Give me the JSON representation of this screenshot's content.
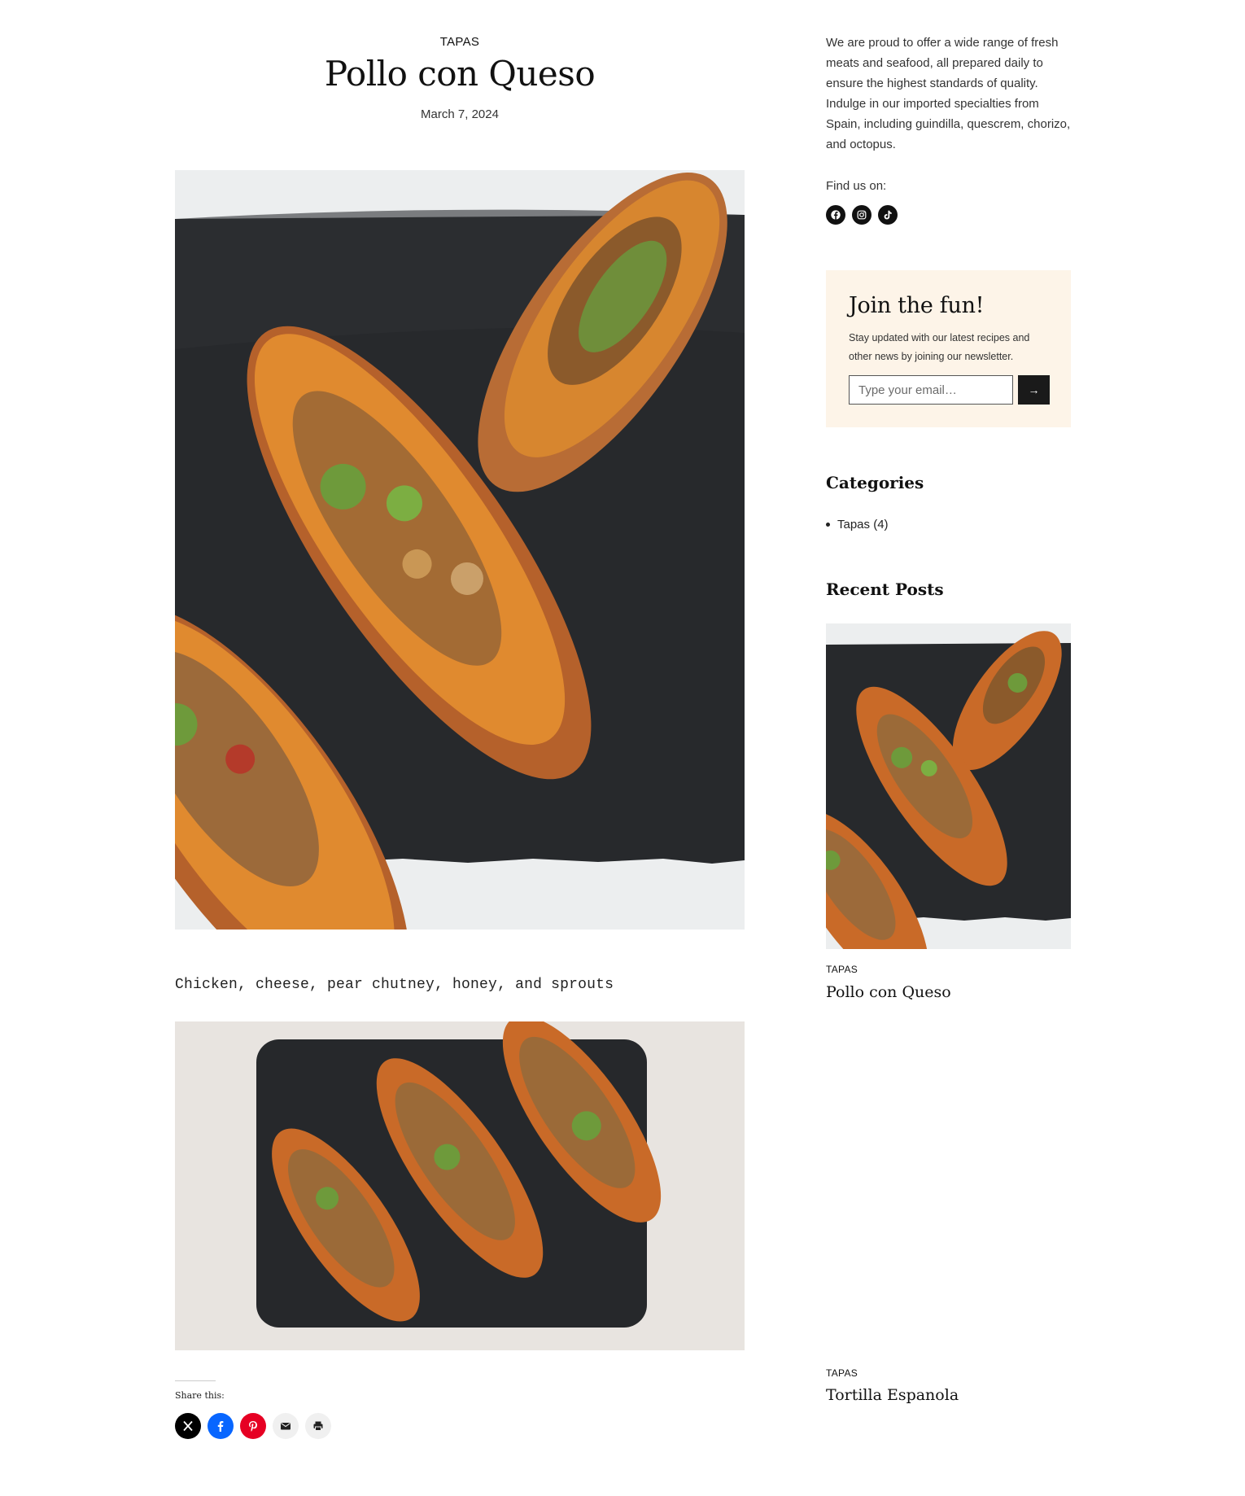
{
  "post": {
    "category": "TAPAS",
    "title": "Pollo con Queso",
    "date": "March 7, 2024",
    "caption": "Chicken, cheese, pear chutney, honey, and sprouts"
  },
  "share": {
    "label": "Share this:",
    "buttons": [
      {
        "name": "x",
        "icon": "x-logo-icon",
        "color": "#000000"
      },
      {
        "name": "facebook",
        "icon": "facebook-icon",
        "color": "#0866ff"
      },
      {
        "name": "pinterest",
        "icon": "pinterest-icon",
        "color": "#e60023"
      },
      {
        "name": "email",
        "icon": "envelope-icon",
        "color": "#f0f0f0"
      },
      {
        "name": "print",
        "icon": "printer-icon",
        "color": "#f0f0f0"
      }
    ]
  },
  "sidebar": {
    "about": "We are proud to offer a wide range of fresh meats and seafood, all prepared daily to ensure the highest standards of quality. Indulge in our imported specialties from Spain, including guindilla, quescrem, chorizo, and octopus.",
    "find_us": "Find us on:",
    "social": [
      "facebook-icon",
      "instagram-icon",
      "tiktok-icon"
    ],
    "newsletter": {
      "title": "Join the fun!",
      "text": "Stay updated with our latest recipes and other news by joining our newsletter.",
      "placeholder": "Type your email…",
      "submit": "→",
      "bg": "#fdf4e8"
    },
    "categories": {
      "title": "Categories",
      "items": [
        {
          "label": "Tapas (4)"
        }
      ]
    },
    "recent_posts": {
      "title": "Recent Posts",
      "items": [
        {
          "category": "TAPAS",
          "title": "Pollo con Queso"
        },
        {
          "category": "TAPAS",
          "title": "Tortilla Espanola"
        }
      ]
    }
  }
}
